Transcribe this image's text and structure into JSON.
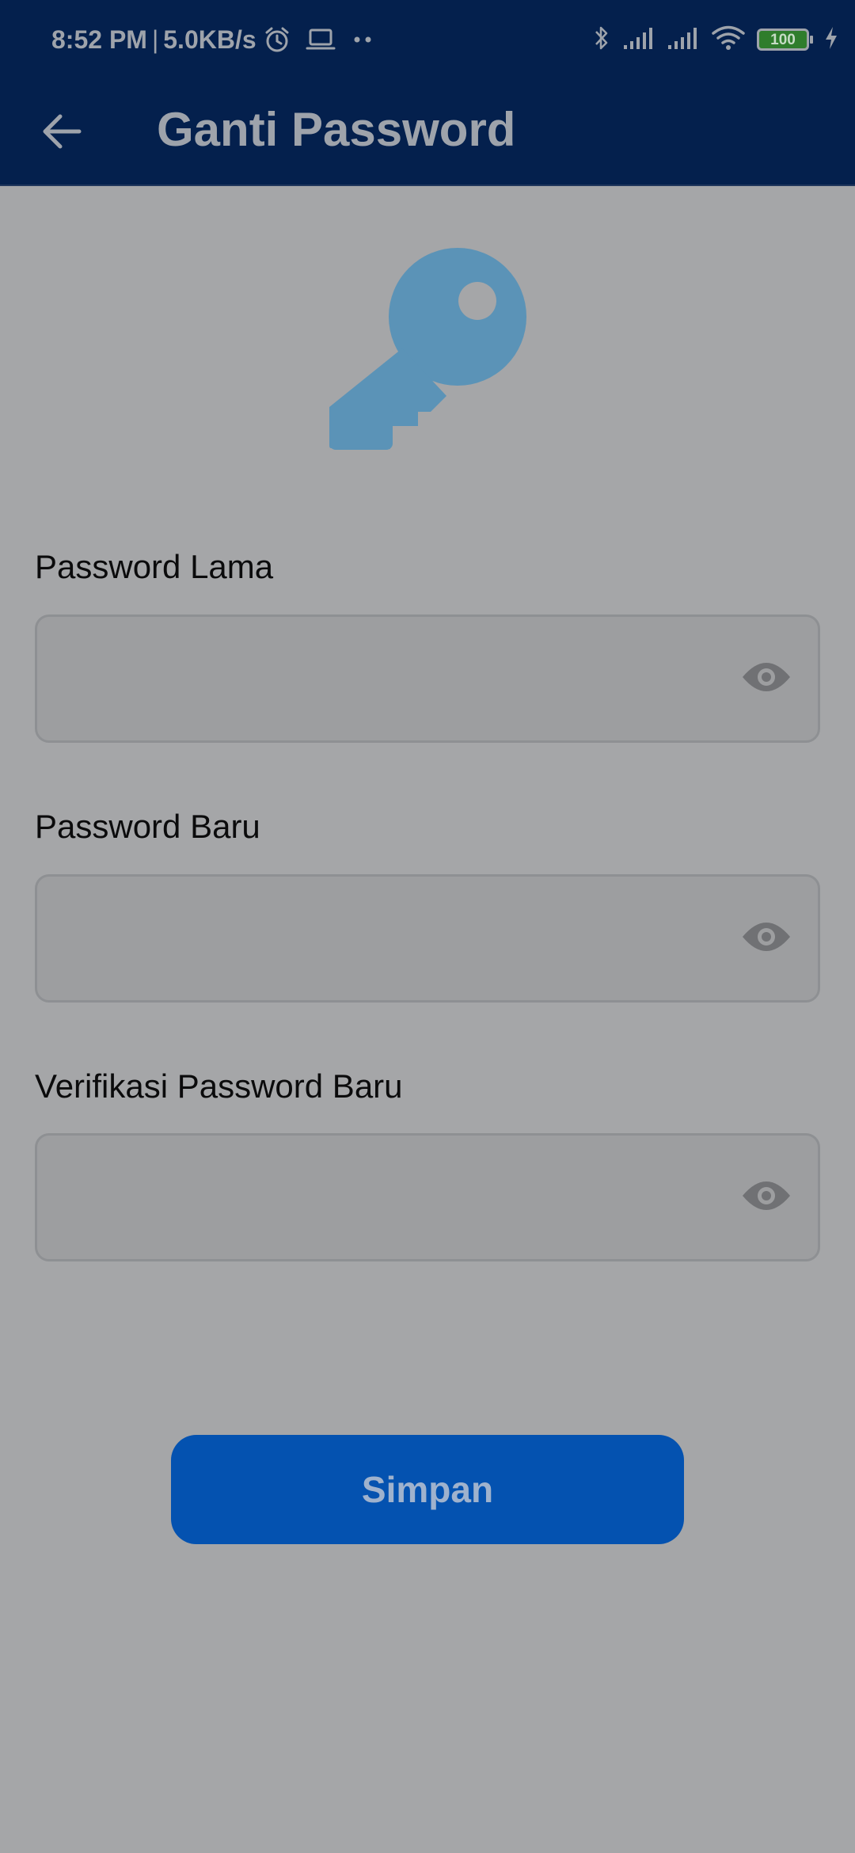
{
  "status_bar": {
    "time": "8:52 PM",
    "separator": "|",
    "network_speed": "5.0KB/s",
    "battery_level": "100",
    "icons": [
      "alarm-icon",
      "laptop-icon",
      "more-dots-icon",
      "bluetooth-icon",
      "signal-icon",
      "signal-icon",
      "wifi-icon",
      "battery-icon",
      "charging-icon"
    ]
  },
  "header": {
    "title": "Ganti Password",
    "back_icon": "arrow-left-icon"
  },
  "illustration": {
    "icon": "key-icon",
    "color": "#5b93b7"
  },
  "form": {
    "fields": [
      {
        "label": "Password Lama",
        "value": "",
        "placeholder": "",
        "toggle_icon": "eye-icon"
      },
      {
        "label": "Password Baru",
        "value": "",
        "placeholder": "",
        "toggle_icon": "eye-icon"
      },
      {
        "label": "Verifikasi Password Baru",
        "value": "",
        "placeholder": "",
        "toggle_icon": "eye-icon"
      }
    ]
  },
  "actions": {
    "save_label": "Simpan"
  },
  "colors": {
    "header_bg": "#04204d",
    "page_bg": "#a5a6a8",
    "accent": "#0452b0",
    "header_text": "#9ea3ab"
  }
}
